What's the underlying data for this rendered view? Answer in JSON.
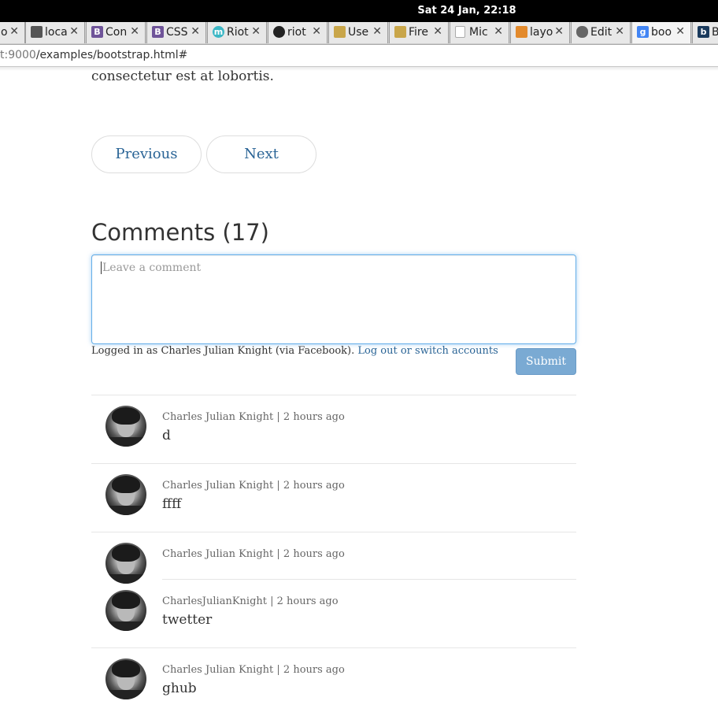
{
  "system": {
    "clock": "Sat 24 Jan, 22:18"
  },
  "tabs": [
    {
      "label": "o",
      "icon": "",
      "color": "#e8e8e8"
    },
    {
      "label": "loca",
      "icon": "page-icon",
      "color": "#555555"
    },
    {
      "label": "Con",
      "icon": "B",
      "color": "#6f5499"
    },
    {
      "label": "CSS",
      "icon": "B",
      "color": "#6f5499"
    },
    {
      "label": "Riot",
      "icon": "m",
      "color": "#3cb7c5"
    },
    {
      "label": "riot",
      "icon": "github-icon",
      "color": "#222222"
    },
    {
      "label": "Use",
      "icon": "db-icon",
      "color": "#c9a64a"
    },
    {
      "label": "Fire",
      "icon": "db-icon",
      "color": "#c9a64a"
    },
    {
      "label": "Mic",
      "icon": "doc-icon",
      "color": "#cfcfcf"
    },
    {
      "label": "layo",
      "icon": "stack-icon",
      "color": "#e38a2c"
    },
    {
      "label": "Edit",
      "icon": "cloud-icon",
      "color": "#666666"
    },
    {
      "label": "boo",
      "icon": "g",
      "color": "#4285f4"
    },
    {
      "label": "B",
      "icon": "b",
      "color": "#1a3a5c"
    }
  ],
  "address_bar": {
    "url_dim": "t:9000",
    "url": "/examples/bootstrap.html#"
  },
  "article": {
    "lead_tail": "consectetur est at lobortis."
  },
  "pager": {
    "previous": "Previous",
    "next": "Next"
  },
  "comments": {
    "title": "Comments (17)",
    "placeholder": "Leave a comment",
    "login_text": "Logged in as Charles Julian Knight (via Facebook).",
    "logout_link": "Log out or switch accounts",
    "submit": "Submit",
    "items": [
      {
        "author": "Charles Julian Knight",
        "time": "2 hours ago",
        "text": "d"
      },
      {
        "author": "Charles Julian Knight",
        "time": "2 hours ago",
        "text": "ffff"
      },
      {
        "author": "Charles Julian Knight",
        "time": "2 hours ago",
        "text": ""
      },
      {
        "author": "CharlesJulianKnight",
        "time": "2 hours ago",
        "text": "twetter"
      },
      {
        "author": "Charles Julian Knight",
        "time": "2 hours ago",
        "text": "ghub"
      }
    ]
  },
  "colors": {
    "link": "#2a6496",
    "focus": "#66afe9",
    "submit_bg": "#7aaad3"
  }
}
